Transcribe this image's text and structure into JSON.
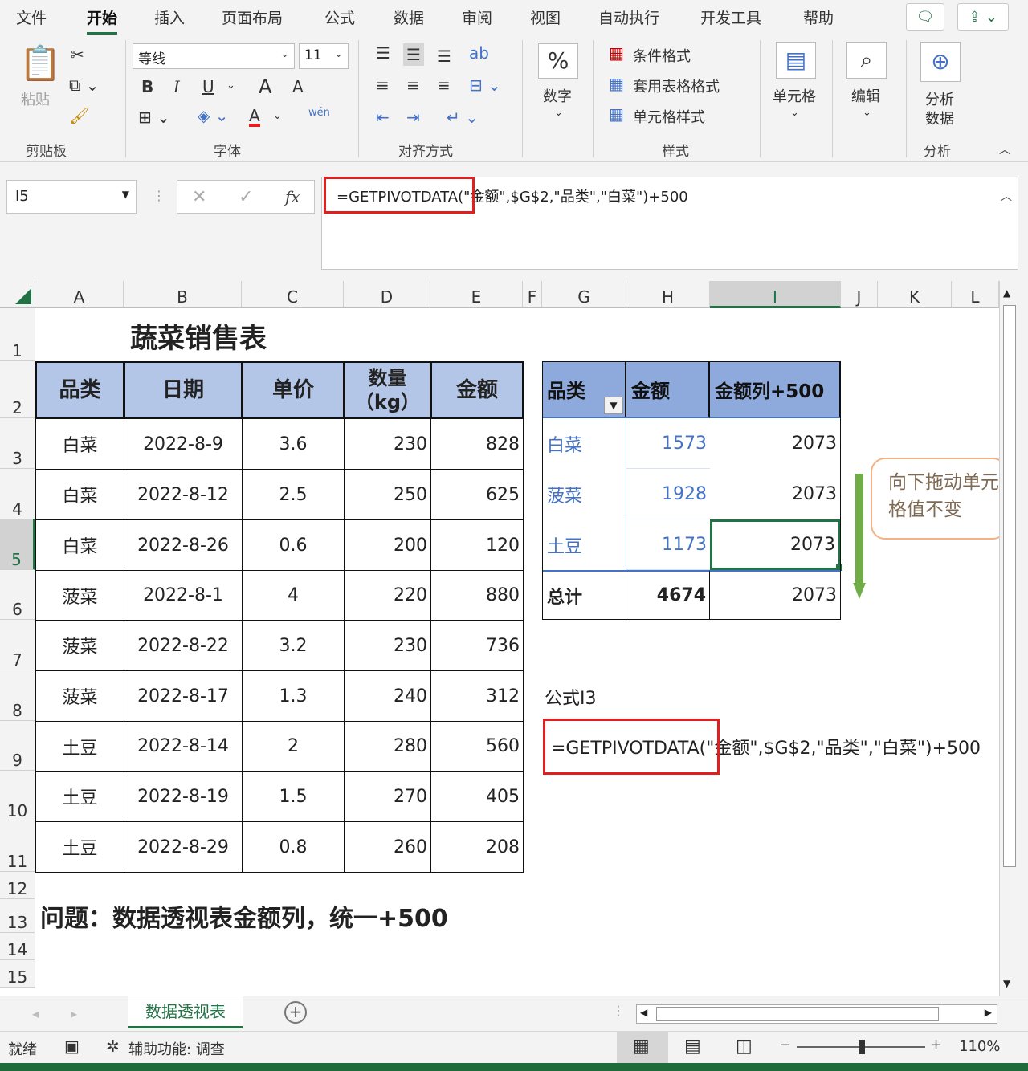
{
  "menu": {
    "tabs": [
      "文件",
      "开始",
      "插入",
      "页面布局",
      "公式",
      "数据",
      "审阅",
      "视图",
      "自动执行",
      "开发工具",
      "帮助"
    ]
  },
  "ribbon": {
    "clipboard": {
      "paste": "粘贴",
      "label": "剪贴板"
    },
    "font": {
      "name": "等线",
      "size": "11",
      "bold": "B",
      "italic": "I",
      "underline": "U",
      "grow": "A",
      "shrink": "A",
      "font_color": "A",
      "phonetic": "wén",
      "label": "字体"
    },
    "alignment": {
      "label": "对齐方式"
    },
    "number": {
      "symbol": "%",
      "label": "数字"
    },
    "styles": {
      "conditional": "条件格式",
      "table": "套用表格格式",
      "cell_style": "单元格样式",
      "label": "样式"
    },
    "cells": {
      "label": "单元格"
    },
    "editing": {
      "label": "编辑"
    },
    "analysis": {
      "btn_line1": "分析",
      "btn_line2": "数据",
      "label": "分析"
    }
  },
  "formula_bar": {
    "name_box": "I5",
    "fx": "fx",
    "formula": "=GETPIVOTDATA(\"金额\",$G$2,\"品类\",\"白菜\")+500"
  },
  "columns": [
    "A",
    "B",
    "C",
    "D",
    "E",
    "F",
    "G",
    "H",
    "I",
    "J",
    "K",
    "L"
  ],
  "rows": [
    "1",
    "2",
    "3",
    "4",
    "5",
    "6",
    "7",
    "8",
    "9",
    "10",
    "11",
    "12",
    "13",
    "14",
    "15"
  ],
  "sheet": {
    "title": "蔬菜销售表",
    "headers": [
      "品类",
      "日期",
      "单价",
      "数量\n（kg）",
      "金额"
    ],
    "data": [
      [
        "白菜",
        "2022-8-9",
        "3.6",
        "230",
        "828"
      ],
      [
        "白菜",
        "2022-8-12",
        "2.5",
        "250",
        "625"
      ],
      [
        "白菜",
        "2022-8-26",
        "0.6",
        "200",
        "120"
      ],
      [
        "菠菜",
        "2022-8-1",
        "4",
        "220",
        "880"
      ],
      [
        "菠菜",
        "2022-8-22",
        "3.2",
        "230",
        "736"
      ],
      [
        "菠菜",
        "2022-8-17",
        "1.3",
        "240",
        "312"
      ],
      [
        "土豆",
        "2022-8-14",
        "2",
        "280",
        "560"
      ],
      [
        "土豆",
        "2022-8-19",
        "1.5",
        "270",
        "405"
      ],
      [
        "土豆",
        "2022-8-29",
        "0.8",
        "260",
        "208"
      ]
    ],
    "pivot": {
      "headers": [
        "品类",
        "金额",
        "金额列+500"
      ],
      "rows": [
        [
          "白菜",
          "1573",
          "2073"
        ],
        [
          "菠菜",
          "1928",
          "2073"
        ],
        [
          "土豆",
          "1173",
          "2073"
        ]
      ],
      "total": [
        "总计",
        "4674",
        "2073"
      ]
    },
    "callout": "向下拖动单元格值不变",
    "formula_label": "公式I3",
    "formula_text": "=GETPIVOTDATA(\"金额\",$G$2,\"品类\",\"白菜\")+500",
    "question": "问题：数据透视表金额列，统一+500"
  },
  "sheet_tab": "数据透视表",
  "status": {
    "ready": "就绪",
    "accessibility": "辅助功能: 调查",
    "zoom": "110%"
  },
  "colors": {
    "accent": "#217346",
    "header_fill": "#b4c6e7",
    "pivot_header": "#8ea9db",
    "highlight": "#e02020",
    "arrow": "#70ad47",
    "callout_border": "#f4b183"
  }
}
